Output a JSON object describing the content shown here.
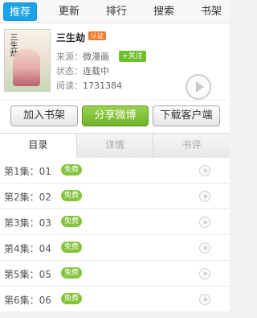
{
  "nav": {
    "items": [
      "推荐",
      "更新",
      "排行",
      "搜索",
      "书架"
    ],
    "active_index": 0
  },
  "book": {
    "title": "三生劫",
    "verified_badge": "认证",
    "cover_title": "三生劫",
    "source_label": "来源：",
    "source_value": "微漫画",
    "follow_label": "+关注",
    "status_label": "状态：",
    "status_value": "连载中",
    "reads_label": "阅读：",
    "reads_value": "1731384"
  },
  "actions": {
    "add_shelf": "加入书架",
    "share_weibo": "分享微博",
    "download_client": "下载客户端"
  },
  "tabs": [
    "目录",
    "详情",
    "书评"
  ],
  "tabs_active_index": 0,
  "episodes": [
    {
      "label": "第1集：01",
      "badge": "免费"
    },
    {
      "label": "第2集：02",
      "badge": "免费"
    },
    {
      "label": "第3集：03",
      "badge": "免费"
    },
    {
      "label": "第4集：04",
      "badge": "免费"
    },
    {
      "label": "第5集：05",
      "badge": "免费"
    },
    {
      "label": "第6集：06",
      "badge": "免费"
    }
  ],
  "colors": {
    "nav_active": "#19a3e8",
    "share_button": "#6cb42a",
    "free_badge": "#86c43e",
    "verified_badge": "#f07a2b"
  }
}
